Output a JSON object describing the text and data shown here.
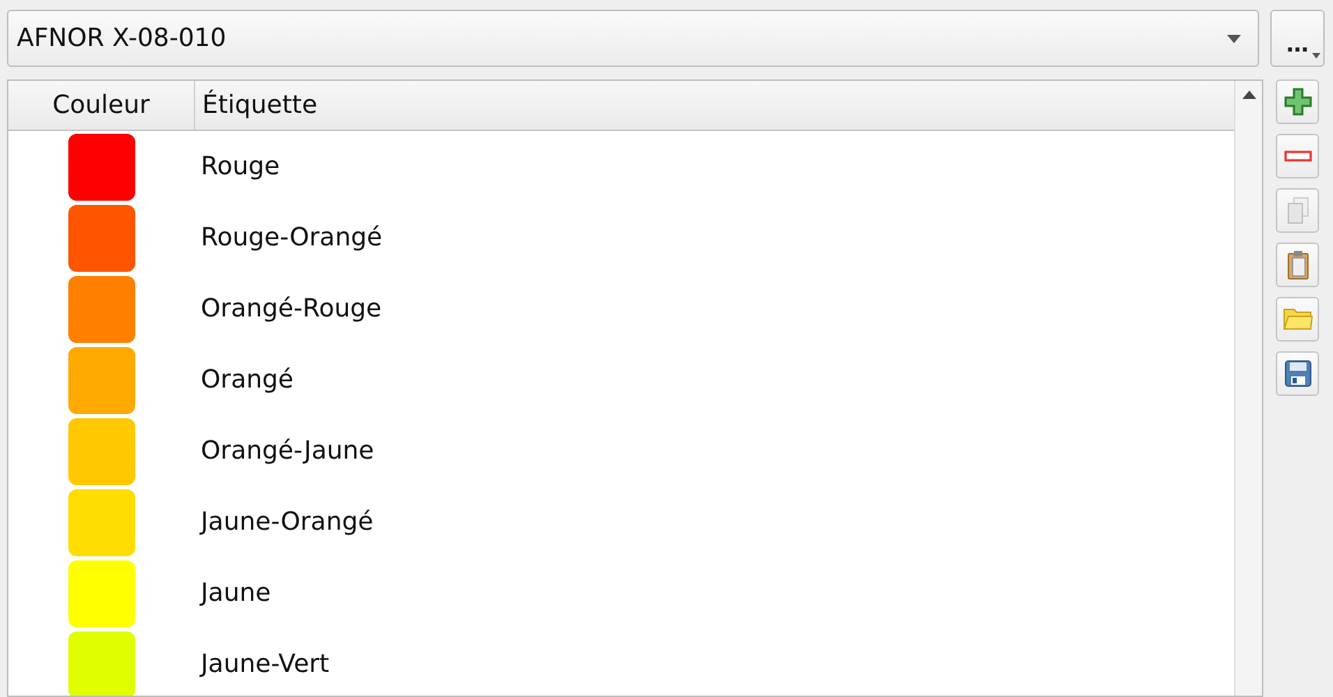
{
  "scheme_select": {
    "value": "AFNOR X-08-010"
  },
  "more_button": {
    "label": "…"
  },
  "table": {
    "columns": [
      "Couleur",
      "Étiquette"
    ],
    "rows": [
      {
        "color": "#ff0000",
        "label": "Rouge"
      },
      {
        "color": "#ff5500",
        "label": "Rouge-Orangé"
      },
      {
        "color": "#ff7f00",
        "label": "Orangé-Rouge"
      },
      {
        "color": "#ffaa00",
        "label": "Orangé"
      },
      {
        "color": "#ffc800",
        "label": "Orangé-Jaune"
      },
      {
        "color": "#ffdd00",
        "label": "Jaune-Orangé"
      },
      {
        "color": "#ffff00",
        "label": "Jaune"
      },
      {
        "color": "#dfff00",
        "label": "Jaune-Vert"
      }
    ]
  },
  "toolbar": [
    {
      "kind": "add",
      "disabled": false
    },
    {
      "kind": "remove",
      "disabled": false
    },
    {
      "kind": "copy",
      "disabled": true
    },
    {
      "kind": "paste",
      "disabled": false
    },
    {
      "kind": "open",
      "disabled": false
    },
    {
      "kind": "save",
      "disabled": false
    }
  ]
}
